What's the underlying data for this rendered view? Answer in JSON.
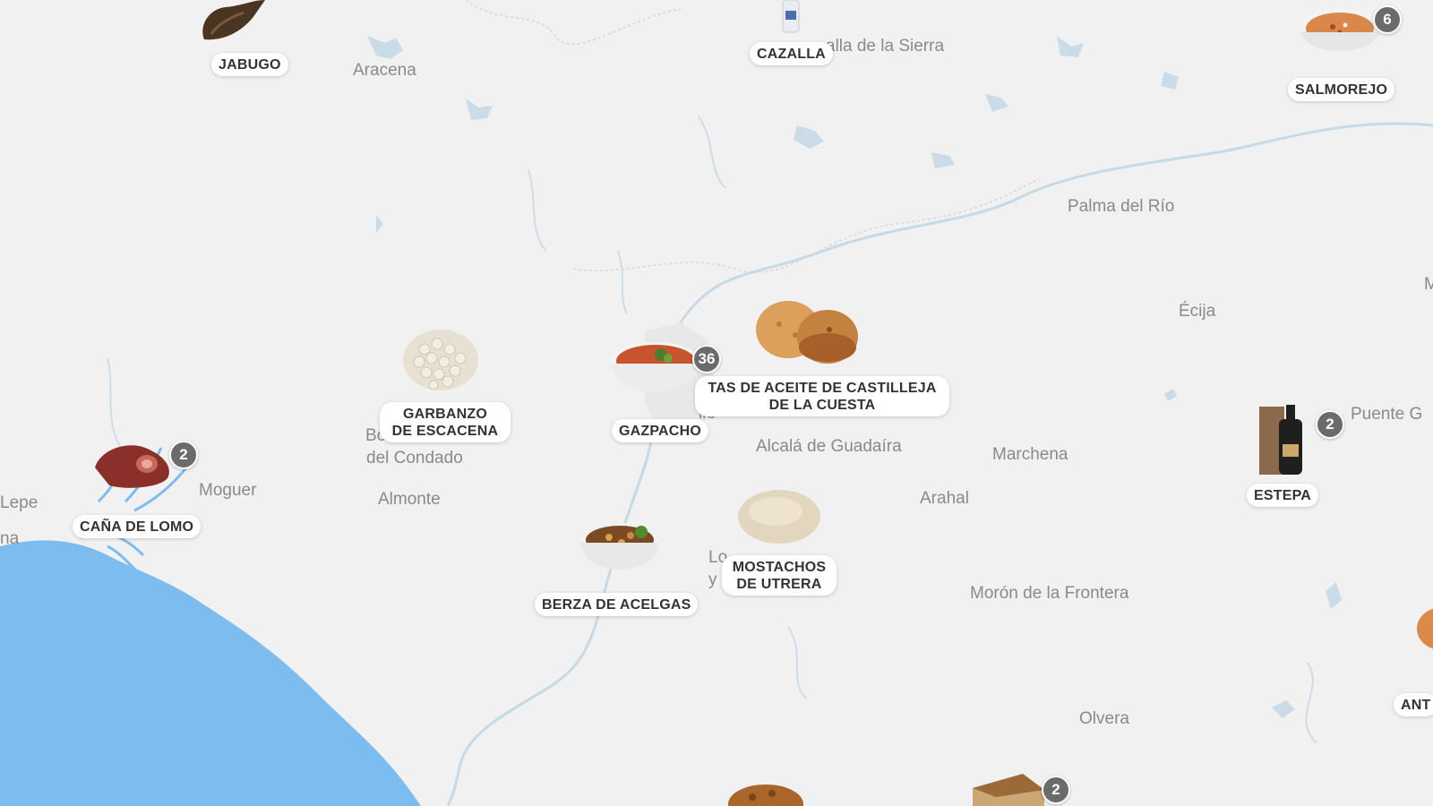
{
  "colors": {
    "land": "#f1f1f1",
    "sea": "#7dbcee",
    "rivers": "#c9dbe6",
    "label": "#8a8a8a",
    "badge": "#6b6b6b"
  },
  "places": [
    {
      "id": "aracena",
      "text": "Aracena"
    },
    {
      "id": "cazalla-sierra",
      "text": "alla de la Sierra"
    },
    {
      "id": "palma-del-rio",
      "text": "Palma del Río"
    },
    {
      "id": "ecija",
      "text": "Écija"
    },
    {
      "id": "m-edge",
      "text": "M"
    },
    {
      "id": "puente",
      "text": "Puente G"
    },
    {
      "id": "bollullos",
      "text": "Bollullos Par"
    },
    {
      "id": "del-condado",
      "text": "del Condado"
    },
    {
      "id": "moguer",
      "text": "Moguer"
    },
    {
      "id": "lepe",
      "text": "Lepe"
    },
    {
      "id": "na",
      "text": "na"
    },
    {
      "id": "almonte",
      "text": "Almonte"
    },
    {
      "id": "sevilla",
      "text": "lle"
    },
    {
      "id": "alcala",
      "text": "Alcalá de Guadaíra"
    },
    {
      "id": "marchena",
      "text": "Marchena"
    },
    {
      "id": "arahal",
      "text": "Arahal"
    },
    {
      "id": "lo",
      "text": "Lo"
    },
    {
      "id": "y",
      "text": "y"
    },
    {
      "id": "moron",
      "text": "Morón de la Frontera"
    },
    {
      "id": "olvera",
      "text": "Olvera"
    }
  ],
  "markers": [
    {
      "id": "jabugo",
      "lines": [
        "JABUGO"
      ],
      "badge": "",
      "icon": "jamon-icon"
    },
    {
      "id": "cazalla",
      "lines": [
        "CAZALLA"
      ],
      "badge": "",
      "icon": "bottle-icon"
    },
    {
      "id": "salmorejo",
      "lines": [
        "SALMOREJO"
      ],
      "badge": "6",
      "icon": "soup-bowl-icon"
    },
    {
      "id": "garbanzo",
      "lines": [
        "GARBANZO",
        "DE ESCACENA"
      ],
      "badge": "",
      "icon": "chickpeas-icon"
    },
    {
      "id": "gazpacho",
      "lines": [
        "GAZPACHO"
      ],
      "badge": "36",
      "icon": "gazpacho-bowl-icon"
    },
    {
      "id": "tortas",
      "lines": [
        "TAS DE ACEITE DE CASTILLEJA",
        "DE LA CUESTA"
      ],
      "badge": "",
      "icon": "tortas-icon"
    },
    {
      "id": "estepa",
      "lines": [
        "ESTEPA"
      ],
      "badge": "2",
      "icon": "oil-bottle-icon"
    },
    {
      "id": "cana-lomo",
      "lines": [
        "CAÑA DE LOMO"
      ],
      "badge": "2",
      "icon": "cured-meat-icon"
    },
    {
      "id": "berza",
      "lines": [
        "BERZA DE ACELGAS"
      ],
      "badge": "",
      "icon": "stew-bowl-icon"
    },
    {
      "id": "mostachos",
      "lines": [
        "MOSTACHOS",
        "DE UTRERA"
      ],
      "badge": "",
      "icon": "bun-icon"
    },
    {
      "id": "antequera",
      "lines": [
        "ANT"
      ],
      "badge": "",
      "icon": "soup-bowl-icon"
    },
    {
      "id": "olvera-food",
      "lines": [],
      "badge": "2",
      "icon": "cake-slice-icon"
    },
    {
      "id": "bottom-dish",
      "lines": [],
      "badge": "",
      "icon": "fried-dish-icon"
    }
  ]
}
